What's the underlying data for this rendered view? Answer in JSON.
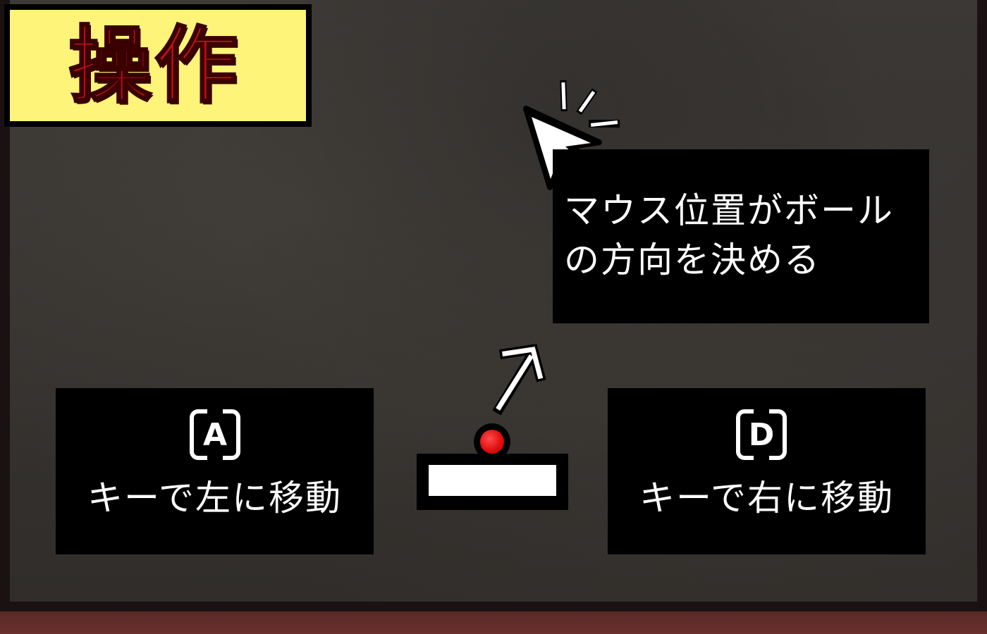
{
  "title": {
    "text": "操作"
  },
  "mouse_hint": {
    "text": "マウス位置がボールの方向を決める"
  },
  "left_control": {
    "key": "A",
    "text": "キーで左に移動"
  },
  "right_control": {
    "key": "D",
    "text": "キーで右に移動"
  },
  "icons": {
    "cursor": "mouse-pointer-click-icon",
    "direction": "direction-arrow-icon",
    "ball": "ball-icon",
    "paddle": "paddle-icon"
  },
  "colors": {
    "title_bg": "#fff47a",
    "title_text": "#c8101c",
    "panel_bg": "#000000",
    "ball": "#e01010",
    "board": "#363330",
    "floor": "#6a302b"
  }
}
